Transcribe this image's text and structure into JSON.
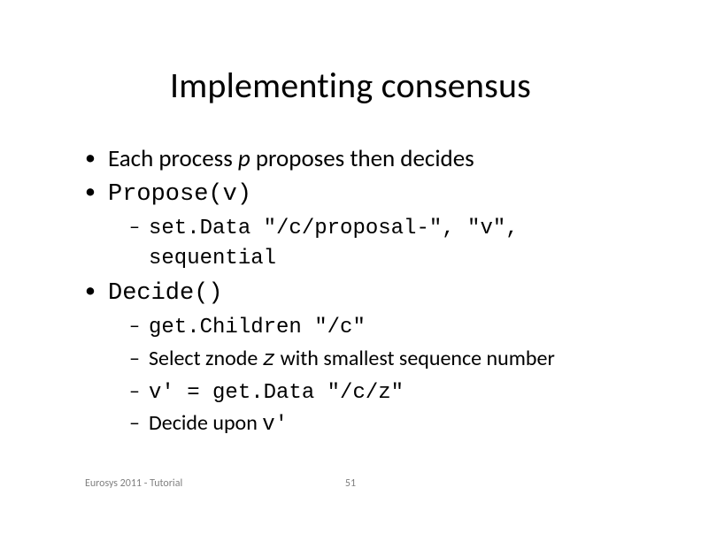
{
  "title": "Implementing consensus",
  "bullets": {
    "l1a_prefix": "Each process ",
    "l1a_p": "p",
    "l1a_suffix": " proposes then decides",
    "propose": "Propose(v)",
    "setdata": "set.Data \"/c/proposal-\", \"v\", sequential",
    "decide": "Decide()",
    "getchildren": "get.Children \"/c\"",
    "select_prefix": "Select znode ",
    "select_z": "z",
    "select_suffix": " with smallest sequence number",
    "vprime_eq": "v' = get.Data \"/c/z\"",
    "decide_upon_prefix": "Decide upon ",
    "decide_upon_v": "v'"
  },
  "footer": {
    "left": "Eurosys 2011 - Tutorial",
    "page": "51"
  }
}
